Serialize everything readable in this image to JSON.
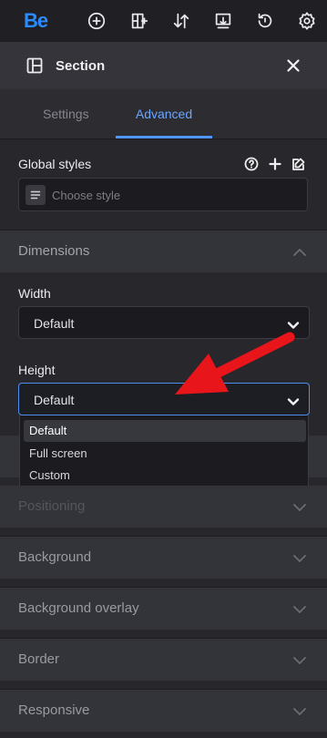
{
  "toolbar": {
    "logo": "Be",
    "icons": [
      "add-circle-icon",
      "add-column-icon",
      "sort-arrows-icon",
      "import-icon",
      "history-icon",
      "settings-gear-icon"
    ]
  },
  "section_header": {
    "title": "Section",
    "close_icon": "close-icon"
  },
  "tabs": [
    {
      "label": "Settings",
      "active": false
    },
    {
      "label": "Advanced",
      "active": true
    }
  ],
  "global_styles": {
    "label": "Global styles",
    "placeholder": "Choose style",
    "icons": [
      "help-icon",
      "plus-icon",
      "edit-style-icon"
    ]
  },
  "dimensions": {
    "title": "Dimensions",
    "width": {
      "label": "Width",
      "value": "Default"
    },
    "height": {
      "label": "Height",
      "value": "Default",
      "options": [
        "Default",
        "Full screen",
        "Custom"
      ],
      "highlighted": "Default"
    }
  },
  "accordions": [
    {
      "label": "Positioning"
    },
    {
      "label": "Background"
    },
    {
      "label": "Background overlay"
    },
    {
      "label": "Border"
    },
    {
      "label": "Responsive"
    }
  ],
  "colors": {
    "accent": "#4f95ff",
    "logo": "#2a8bff",
    "annotation_arrow": "#e8151b"
  }
}
